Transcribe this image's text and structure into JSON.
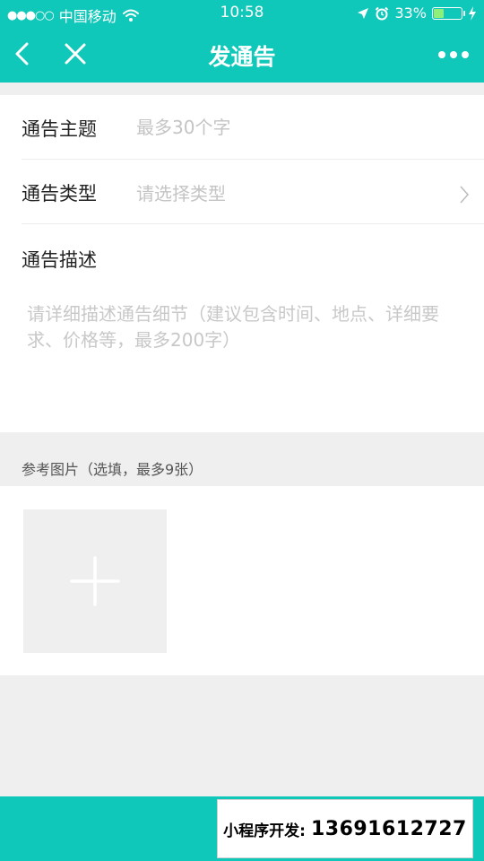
{
  "status_bar": {
    "signal": "●●●○○",
    "carrier": "中国移动",
    "time": "10:58",
    "battery_percent": "33%",
    "battery_level": 0.33
  },
  "nav": {
    "title": "发通告"
  },
  "form": {
    "subject": {
      "label": "通告主题",
      "placeholder": "最多30个字"
    },
    "type": {
      "label": "通告类型",
      "placeholder": "请选择类型"
    },
    "description": {
      "label": "通告描述",
      "placeholder": "请详细描述通告细节（建议包含时间、地点、详细要求、价格等，最多200字）"
    }
  },
  "images": {
    "section_label": "参考图片（选填，最多9张）"
  },
  "promo": {
    "label": "小程序开发:",
    "phone": "13691612727"
  },
  "colors": {
    "primary": "#10c8b9",
    "background": "#efefef",
    "placeholder": "#c4c4c4"
  }
}
